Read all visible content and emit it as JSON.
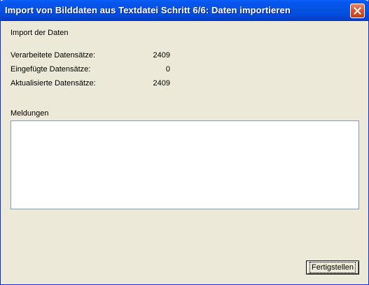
{
  "window": {
    "title": "Import von Bilddaten aus Textdatei Schritt 6/6: Daten importieren"
  },
  "section": {
    "heading": "Import der Daten"
  },
  "stats": [
    {
      "label": "Verarbeitete Datensätze:",
      "value": "2409"
    },
    {
      "label": "Eingefügte Datensätze:",
      "value": "0"
    },
    {
      "label": "Aktualisierte Datensätze:",
      "value": "2409"
    }
  ],
  "messages": {
    "label": "Meldungen",
    "content": ""
  },
  "buttons": {
    "finish_label": "Fertigstellen"
  },
  "colors": {
    "titlebar": "#0453e4",
    "dialog_bg": "#ece9d8",
    "close_button": "#d5532d"
  }
}
